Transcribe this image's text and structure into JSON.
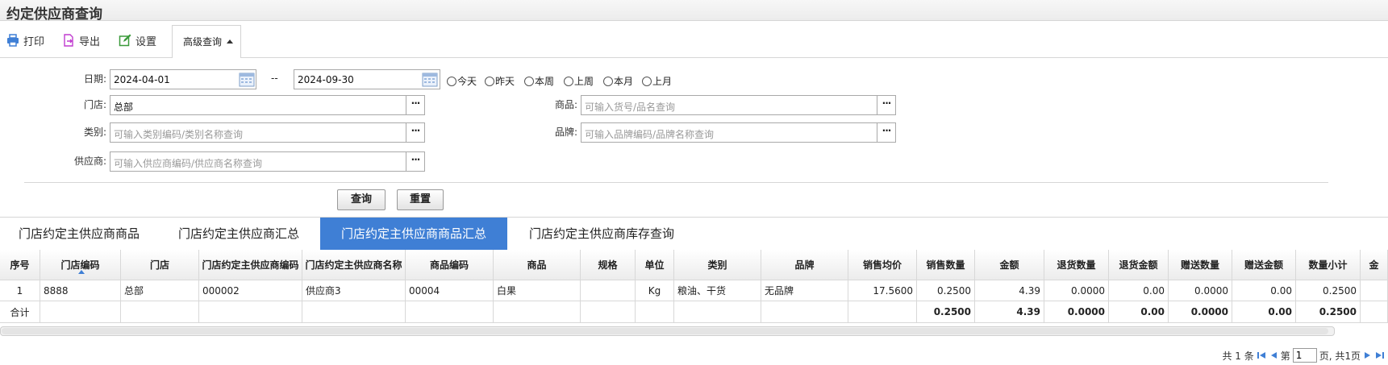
{
  "window": {
    "title": "约定供应商查询"
  },
  "toolbar": {
    "print_label": "打印",
    "export_label": "导出",
    "settings_label": "设置",
    "advanced_label": "高级查询"
  },
  "form": {
    "date_label": "日期:",
    "date_from": "2024-04-01",
    "date_sep": "--",
    "date_to": "2024-09-30",
    "quick_dates": [
      "今天",
      "昨天",
      "本周",
      "上周",
      "本月",
      "上月"
    ],
    "store_label": "门店:",
    "store_value": "总部",
    "category_label": "类别:",
    "category_placeholder": "可输入类别编码/类别名称查询",
    "supplier_label": "供应商:",
    "supplier_placeholder": "可输入供应商编码/供应商名称查询",
    "product_label": "商品:",
    "product_placeholder": "可输入货号/品名查询",
    "brand_label": "品牌:",
    "brand_placeholder": "可输入品牌编码/品牌名称查询",
    "more_label": "···",
    "query_button": "查询",
    "reset_button": "重置"
  },
  "tabs": [
    "门店约定主供应商商品",
    "门店约定主供应商汇总",
    "门店约定主供应商商品汇总",
    "门店约定主供应商库存查询"
  ],
  "active_tab": 2,
  "table": {
    "headers": [
      "序号",
      "门店编码",
      "门店",
      "门店约定主供应商编码",
      "门店约定主供应商名称",
      "商品编码",
      "商品",
      "规格",
      "单位",
      "类别",
      "品牌",
      "销售均价",
      "销售数量",
      "金额",
      "退货数量",
      "退货金额",
      "赠送数量",
      "赠送金额",
      "数量小计",
      "金"
    ],
    "rows": [
      [
        "1",
        "8888",
        "总部",
        "000002",
        "供应商3",
        "00004",
        "白果",
        "",
        "Kg",
        "粮油、干货",
        "无品牌",
        "17.5600",
        "0.2500",
        "4.39",
        "0.0000",
        "0.00",
        "0.0000",
        "0.00",
        "0.2500",
        ""
      ]
    ],
    "total_row": [
      "合计",
      "",
      "",
      "",
      "",
      "",
      "",
      "",
      "",
      "",
      "",
      "",
      "0.2500",
      "4.39",
      "0.0000",
      "0.00",
      "0.0000",
      "0.00",
      "0.2500",
      ""
    ]
  },
  "pager": {
    "total_text": "共 1 条",
    "page_prefix": "第",
    "page_value": "1",
    "page_suffix": "页, 共1页"
  },
  "colors": {
    "accent": "#3f7fd5",
    "tab_active": "#3f7fd5"
  }
}
